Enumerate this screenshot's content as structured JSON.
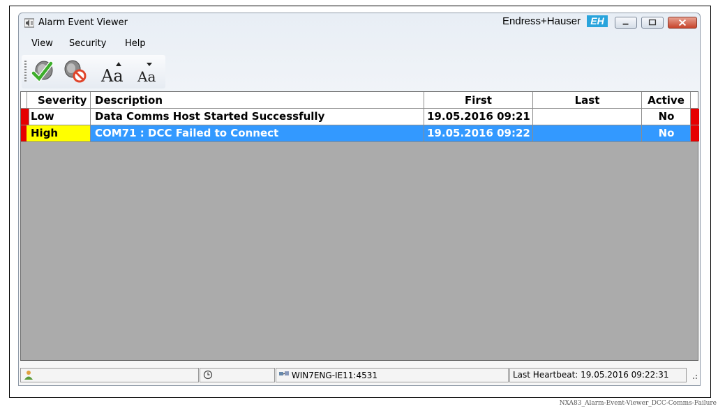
{
  "window": {
    "title": "Alarm Event Viewer",
    "brand_name": "Endress+Hauser",
    "brand_logo": "EH"
  },
  "menu": {
    "items": [
      "View",
      "Security",
      "Help"
    ]
  },
  "toolbar": {
    "buttons": [
      {
        "icon": "acknowledge-speaker-icon"
      },
      {
        "icon": "mute-speaker-icon"
      },
      {
        "icon": "increase-font-icon",
        "label": "Aa"
      },
      {
        "icon": "decrease-font-icon",
        "label": "Aa"
      }
    ]
  },
  "grid": {
    "columns": [
      "Severity",
      "Description",
      "First",
      "Last",
      "Active"
    ],
    "rows": [
      {
        "severity": "Low",
        "description": "Data Comms Host Started Successfully",
        "first": "19.05.2016 09:21",
        "last": "",
        "active": "No",
        "selected": false
      },
      {
        "severity": "High",
        "description": "COM71 : DCC Failed to Connect",
        "first": "19.05.2016 09:22",
        "last": "",
        "active": "No",
        "selected": true
      }
    ]
  },
  "status": {
    "server": "WIN7ENG-IE11:4531",
    "heartbeat": "Last Heartbeat: 19.05.2016 09:22:31"
  },
  "caption": "NXA83_Alarm-Event-Viewer_DCC-Comms-Failure",
  "colors": {
    "selection": "#3399ff",
    "alarm_marker": "#e60000",
    "high_severity": "#ffff00",
    "grid_background": "#ababab"
  }
}
